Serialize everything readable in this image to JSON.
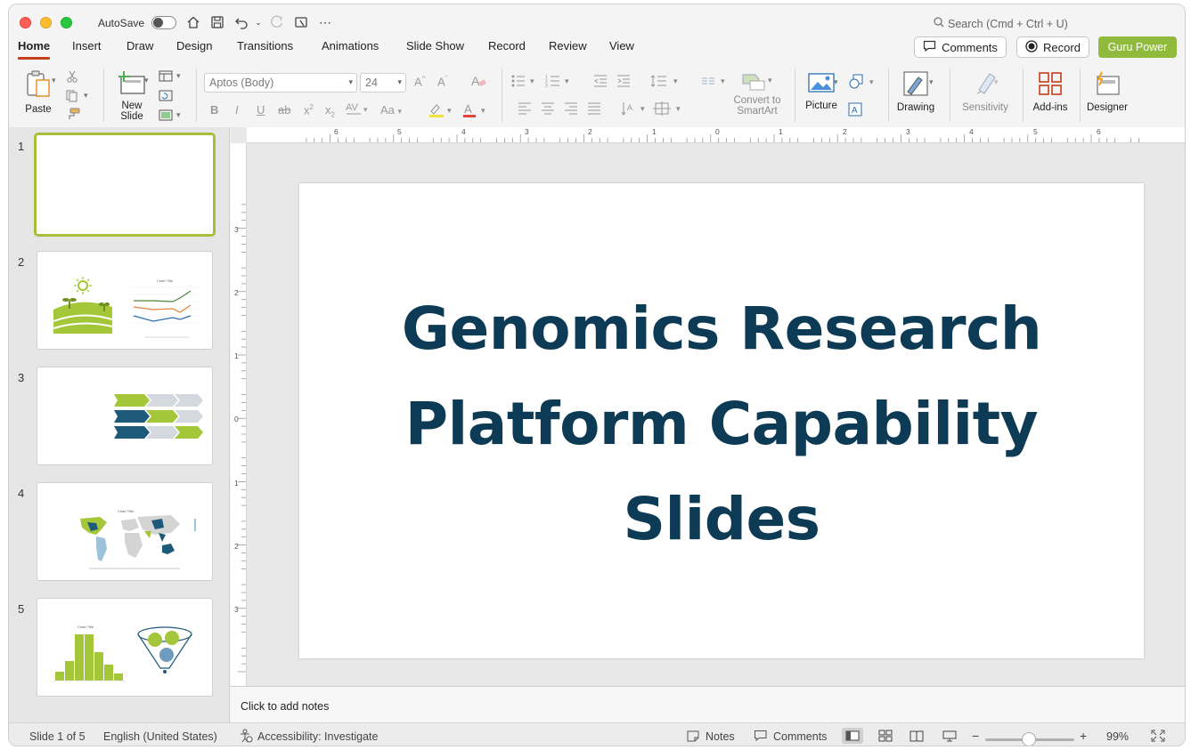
{
  "titlebar": {
    "autosave_label": "AutoSave",
    "search_placeholder": "Search (Cmd + Ctrl + U)"
  },
  "tabs": [
    {
      "label": "Home",
      "active": true
    },
    {
      "label": "Insert"
    },
    {
      "label": "Draw"
    },
    {
      "label": "Design"
    },
    {
      "label": "Transitions"
    },
    {
      "label": "Animations"
    },
    {
      "label": "Slide Show"
    },
    {
      "label": "Record"
    },
    {
      "label": "Review"
    },
    {
      "label": "View"
    }
  ],
  "header_buttons": {
    "comments": "Comments",
    "record": "Record",
    "guru": "Guru Power"
  },
  "ribbon": {
    "paste": "Paste",
    "new_slide": "New\nSlide",
    "font_name": "Aptos (Body)",
    "font_size": "24",
    "convert_smartart": "Convert to\nSmartArt",
    "picture": "Picture",
    "drawing": "Drawing",
    "sensitivity": "Sensitivity",
    "addins": "Add-ins",
    "designer": "Designer"
  },
  "slides_panel": {
    "numbers": [
      "1",
      "2",
      "3",
      "4",
      "5"
    ],
    "thumb2_chart_title": "Chart Title",
    "thumb4_chart_title": "Chart Title",
    "thumb5_chart_title": "Chart Title"
  },
  "slide": {
    "title_line1": "Genomics Research",
    "title_line2": "Platform Capability",
    "title_line3": "Slides"
  },
  "ruler_top": [
    "6",
    "5",
    "4",
    "3",
    "2",
    "1",
    "0",
    "1",
    "2",
    "3",
    "4",
    "5",
    "6"
  ],
  "ruler_left": [
    "3",
    "2",
    "1",
    "0",
    "1",
    "2",
    "3"
  ],
  "notes": {
    "placeholder": "Click to add notes"
  },
  "status": {
    "slide_count": "Slide 1 of 5",
    "language": "English (United States)",
    "accessibility": "Accessibility: Investigate",
    "notes": "Notes",
    "comments": "Comments",
    "zoom": "99%"
  },
  "colors": {
    "accent_tab": "#c43e1c",
    "guru": "#8fba3c",
    "title_text": "#0d3b55",
    "lime": "#a4c639",
    "navy": "#1d5a7a"
  }
}
